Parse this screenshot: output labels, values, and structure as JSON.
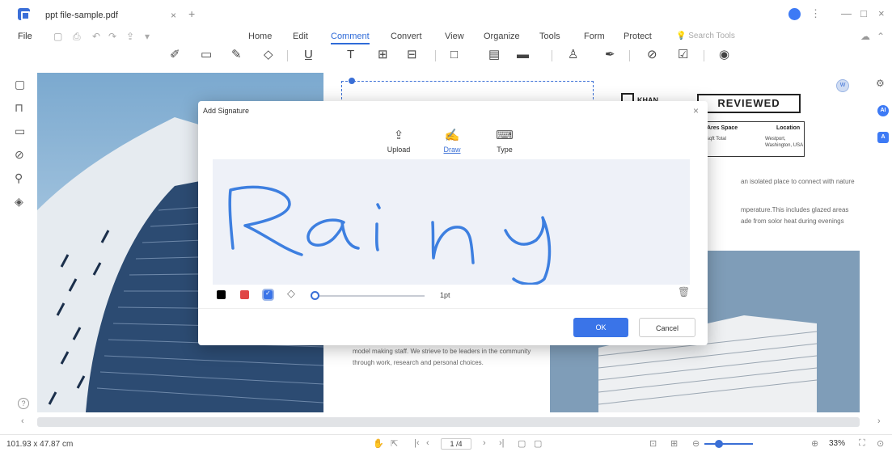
{
  "window": {
    "tab_title": "ppt file-sample.pdf",
    "tab_close": "×",
    "tab_add": "+",
    "minimize": "—",
    "maximize": "□",
    "close": "×",
    "more": "⋮"
  },
  "menu": {
    "file": "File",
    "tabs": [
      "Home",
      "Edit",
      "Comment",
      "Convert",
      "View",
      "Organize",
      "Tools",
      "Form",
      "Protect"
    ],
    "active_tab": "Comment",
    "search_placeholder": "Search Tools"
  },
  "dialog": {
    "title": "Add Signature",
    "close": "×",
    "modes": [
      {
        "label": "Upload",
        "icon": "upload-icon"
      },
      {
        "label": "Draw",
        "icon": "draw-icon"
      },
      {
        "label": "Type",
        "icon": "keyboard-icon"
      }
    ],
    "active_mode": "Draw",
    "signature_text": "Rainy",
    "signature_color": "#3d7fe0",
    "colors": [
      "#000000",
      "#e04646",
      "#3a74e8"
    ],
    "selected_color": "#3a74e8",
    "thickness_label": "1pt",
    "ok_label": "OK",
    "cancel_label": "Cancel"
  },
  "document": {
    "body_text": "model making staff. We strieve to be leaders in the community through work, research and personal choices.",
    "right_text_1": "an isolated place to connect with nature",
    "right_text_2": "mperature.This includes glazed areas",
    "right_text_3": "ade from solor heat during evenings",
    "reviewed_stamp": "REVIEWED",
    "logo_text": "KHAN",
    "table": {
      "col1_header": "Ares Space",
      "col1_value": "sqft Total",
      "col2_header": "Location",
      "col2_value_1": "Westport,",
      "col2_value_2": "Washington, USA"
    },
    "page_badge": "W"
  },
  "status": {
    "dimensions": "101.93 x 47.87 cm",
    "page_indicator": "1 /4",
    "zoom": "33%"
  }
}
